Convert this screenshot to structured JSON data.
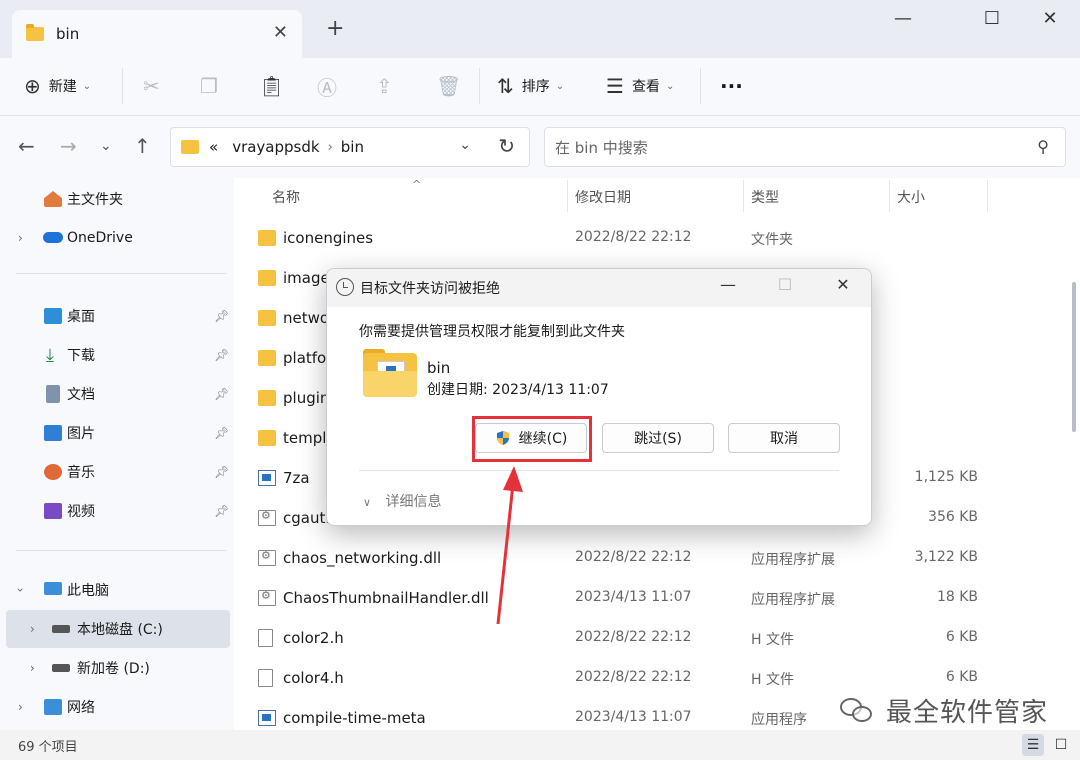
{
  "window": {
    "tab_title": "bin",
    "tab_close": "✕",
    "new_tab": "+",
    "controls": {
      "minimize": "—",
      "maximize": "☐",
      "close": "✕"
    }
  },
  "toolbar": {
    "new_label": "新建",
    "sort_label": "排序",
    "view_label": "查看",
    "more_label": "···"
  },
  "address": {
    "overflow": "«",
    "segments": [
      "vrayappsdk",
      "bin"
    ],
    "search_placeholder": "在 bin 中搜索"
  },
  "sidebar": {
    "items": [
      {
        "label": "主文件夹",
        "icon": "home-icon"
      },
      {
        "label": "OneDrive",
        "icon": "cloud-icon"
      },
      {
        "label": "桌面",
        "icon": "desktop-icon",
        "pinned": true
      },
      {
        "label": "下载",
        "icon": "download-icon",
        "pinned": true
      },
      {
        "label": "文档",
        "icon": "document-icon",
        "pinned": true
      },
      {
        "label": "图片",
        "icon": "picture-icon",
        "pinned": true
      },
      {
        "label": "音乐",
        "icon": "music-icon",
        "pinned": true
      },
      {
        "label": "视频",
        "icon": "video-icon",
        "pinned": true
      },
      {
        "label": "此电脑",
        "icon": "computer-icon"
      },
      {
        "label": "本地磁盘 (C:)",
        "icon": "drive-icon",
        "selected": true
      },
      {
        "label": "新加卷 (D:)",
        "icon": "drive-icon"
      },
      {
        "label": "网络",
        "icon": "network-icon"
      }
    ]
  },
  "columns": {
    "name": "名称",
    "date": "修改日期",
    "type": "类型",
    "size": "大小"
  },
  "files": [
    {
      "name": "iconengines",
      "date": "2022/8/22 22:12",
      "type": "文件夹",
      "size": "",
      "icon": "folder"
    },
    {
      "name": "image",
      "date": "",
      "type": "",
      "size": "",
      "icon": "folder"
    },
    {
      "name": "netwo",
      "date": "",
      "type": "",
      "size": "",
      "icon": "folder"
    },
    {
      "name": "platfo",
      "date": "",
      "type": "",
      "size": "",
      "icon": "folder"
    },
    {
      "name": "plugin",
      "date": "",
      "type": "",
      "size": "",
      "icon": "folder"
    },
    {
      "name": "templ",
      "date": "",
      "type": "",
      "size": "",
      "icon": "folder"
    },
    {
      "name": "7za",
      "date": "",
      "type": "",
      "size": "1,125 KB",
      "icon": "exe"
    },
    {
      "name": "cgautl",
      "date": "",
      "type": "",
      "size": "356 KB",
      "icon": "dll"
    },
    {
      "name": "chaos_networking.dll",
      "date": "2022/8/22 22:12",
      "type": "应用程序扩展",
      "size": "3,122 KB",
      "icon": "dll"
    },
    {
      "name": "ChaosThumbnailHandler.dll",
      "date": "2023/4/13 11:07",
      "type": "应用程序扩展",
      "size": "18 KB",
      "icon": "dll"
    },
    {
      "name": "color2.h",
      "date": "2022/8/22 22:12",
      "type": "H 文件",
      "size": "6 KB",
      "icon": "h"
    },
    {
      "name": "color4.h",
      "date": "2022/8/22 22:12",
      "type": "H 文件",
      "size": "6 KB",
      "icon": "h"
    },
    {
      "name": "compile-time-meta",
      "date": "2023/4/13 11:07",
      "type": "应用程序",
      "size": "",
      "icon": "exe"
    }
  ],
  "status": {
    "count": "69 个项目"
  },
  "dialog": {
    "title": "目标文件夹访问被拒绝",
    "message": "你需要提供管理员权限才能复制到此文件夹",
    "folder_name": "bin",
    "folder_date": "创建日期: 2023/4/13 11:07",
    "continue_label": "继续(C)",
    "skip_label": "跳过(S)",
    "cancel_label": "取消",
    "details_label": "详细信息"
  },
  "watermark": {
    "text": "最全软件管家"
  },
  "colors": {
    "accent_red": "#e5323a",
    "folder_yellow": "#f5c242",
    "shield_blue": "#2b72c7"
  }
}
